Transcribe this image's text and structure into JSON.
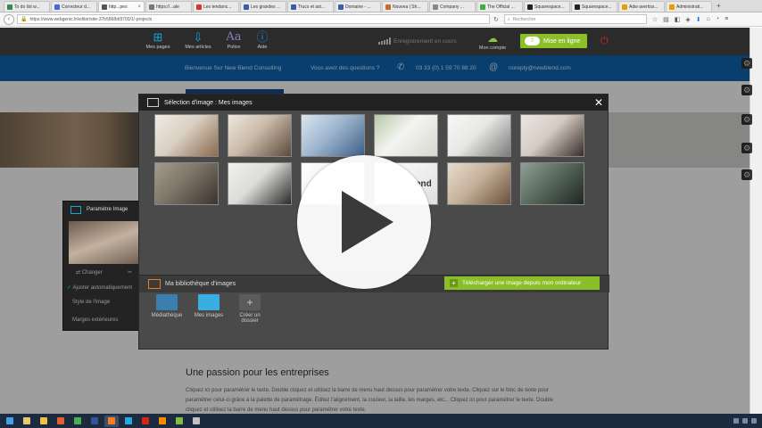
{
  "browser": {
    "tabs": [
      {
        "label": "To do list w...",
        "color": "#2e8b57"
      },
      {
        "label": "Correcteur d...",
        "color": "#4169e1"
      },
      {
        "label": "http...pes",
        "color": "#555555",
        "active": true
      },
      {
        "label": "https://...ale",
        "color": "#777777"
      },
      {
        "label": "Les tendanc...",
        "color": "#d33"
      },
      {
        "label": "Les grandes ...",
        "color": "#3a5da8"
      },
      {
        "label": "Trucs et ast...",
        "color": "#3a5da8"
      },
      {
        "label": "Domaine - ...",
        "color": "#3a5da8"
      },
      {
        "label": "Nouvea | Sh...",
        "color": "#c63"
      },
      {
        "label": "Company ...",
        "color": "#888"
      },
      {
        "label": "The Official ...",
        "color": "#4a4"
      },
      {
        "label": "Squarespace...",
        "color": "#222"
      },
      {
        "label": "Squarespace...",
        "color": "#222"
      },
      {
        "label": "Adw avertiss...",
        "color": "#e5a000"
      },
      {
        "label": "Administrati...",
        "color": "#e5a000"
      }
    ],
    "url": "https://www.webgenic.fr/editor/site-37b5868d/9700/1/-projects",
    "search_placeholder": "Rechercher"
  },
  "app_toolbar": {
    "items": [
      {
        "label": "Mes pages",
        "icon": "pages-icon"
      },
      {
        "label": "Mes articles",
        "icon": "articles-icon"
      },
      {
        "label": "Police",
        "icon": "font-icon"
      },
      {
        "label": "Aide",
        "icon": "help-icon"
      }
    ],
    "status": "Enregistrement en cours",
    "account_label": "Mon compte",
    "save_label": "Mise en ligne"
  },
  "banner": {
    "welcome": "Bienvenue Sur New Blend Consulting",
    "question": "Vous avez des questions ?",
    "phone": "03 33 (0) 1 59 70 88 20",
    "email": "noreply@newblend.com"
  },
  "page": {
    "heading": "Une passion pour les entreprises",
    "body": "Cliquez ici pour paramétrer le texte. Double cliquez et utilisez la barre de menu haut dessus pour paramétrer votre texte. Cliquez sur le bloc de texte pour paramétrer celui-ci grâce à la palette de paramétrage. Éditez l'alignement, la couleur, la taille, les marges, etc... Cliquez ici pour paramétrer le texte. Double cliquez et utilisez la barre de menu haut dessus pour paramétrer votre texte."
  },
  "left_panel": {
    "title": "Paramètre Image",
    "change": "Changer",
    "auto_adjust": "Ajuster automatiquement",
    "style": "Style de l'image",
    "margins": "Marges extérieures"
  },
  "modal": {
    "title": "Sélection d'image : Mes images",
    "library_label": "Ma bibliothèque d'images",
    "upload_label": "Télécharger une image depuis mon ordinateur",
    "hidden_text": "end",
    "folders": [
      {
        "label": "Médiathèque",
        "icon": "media-library-icon"
      },
      {
        "label": "Mes images",
        "icon": "folder-icon"
      },
      {
        "label": "Créer un dossier",
        "icon": "new-folder-icon"
      }
    ],
    "images": [
      {
        "name": "meeting-room-image",
        "colors": [
          "#d9cfc2",
          "#8a6a4e",
          "#f1ebe3"
        ]
      },
      {
        "name": "coffee-desk-image",
        "colors": [
          "#c9b9a8",
          "#5c4a3a",
          "#efe7dd"
        ]
      },
      {
        "name": "glass-building-image",
        "colors": [
          "#9fb6cf",
          "#3d5f86",
          "#dbe6f0"
        ]
      },
      {
        "name": "white-desk-image",
        "colors": [
          "#f4f4f2",
          "#d6d8cf",
          "#b8c8a8"
        ]
      },
      {
        "name": "laptop-flatlay-image",
        "colors": [
          "#e8e8e6",
          "#7a7a78",
          "#f7f7f5"
        ]
      },
      {
        "name": "woman-portrait-image",
        "colors": [
          "#d4cbc3",
          "#3a2d27",
          "#ece7e2"
        ]
      },
      {
        "name": "man-thinking-image",
        "colors": [
          "#7d7468",
          "#3b342d",
          "#a59a8c"
        ]
      },
      {
        "name": "man-whiteboard-image",
        "colors": [
          "#dcdcd8",
          "#2a2a28",
          "#f1f1ee"
        ]
      },
      {
        "name": "text-card-image",
        "colors": [
          "#f2f2f2",
          "#e0e0e0",
          "#ffffff"
        ]
      },
      {
        "name": "blank-card-image",
        "colors": [
          "#f2f2f2",
          "#e0e0e0",
          "#ffffff"
        ]
      },
      {
        "name": "office-interior-image",
        "colors": [
          "#c7b29b",
          "#6a503a",
          "#e6dccf"
        ]
      },
      {
        "name": "laptop-work-image",
        "colors": [
          "#5a6a5e",
          "#1f2621",
          "#8fa094"
        ]
      }
    ]
  }
}
